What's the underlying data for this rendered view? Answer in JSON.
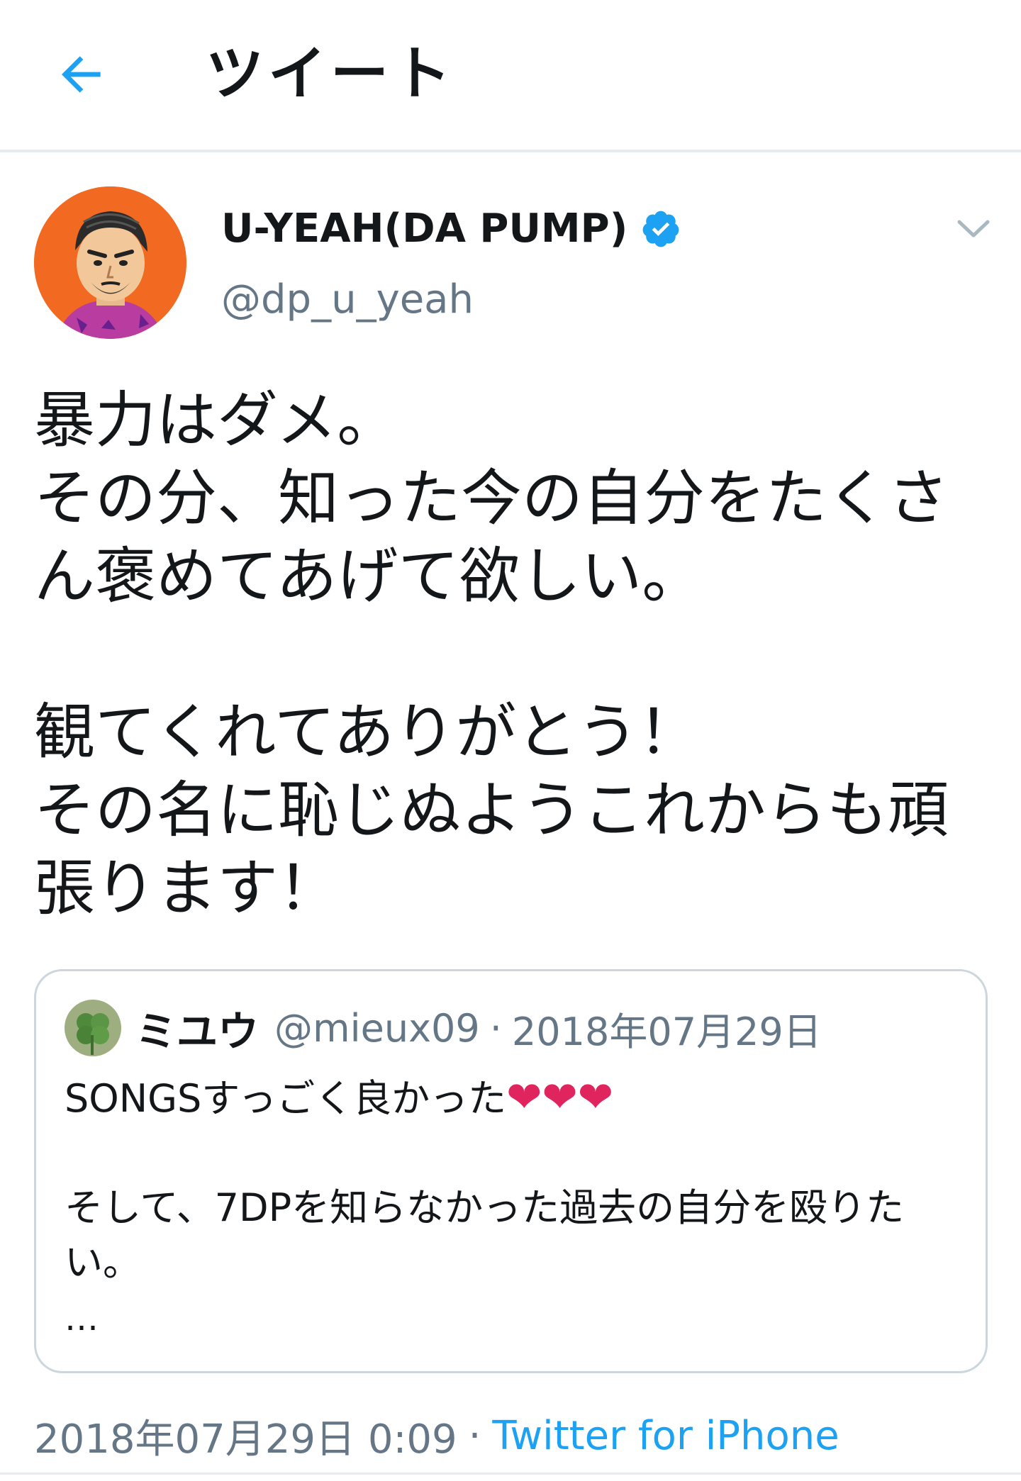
{
  "header": {
    "title": "ツイート",
    "back_icon": "arrow-left-icon",
    "accent_color": "#1da1f2"
  },
  "tweet": {
    "author": {
      "name": "U-YEAH(DA PUMP)",
      "handle": "@dp_u_yeah",
      "verified": true,
      "avatar_icon": "cartoon-avatar"
    },
    "more_icon": "chevron-down-icon",
    "text": "暴力はダメ。\nその分、知った今の自分をたくさん褒めてあげて欲しい。\n\n観てくれてありがとう！\nその名に恥じぬようこれからも頑張ります！",
    "quoted": {
      "name": "ミユウ",
      "handle": "@mieux09",
      "separator": "·",
      "date": "2018年07月29日",
      "text_line1": "SONGSすっごく良かった",
      "hearts": "❤❤❤",
      "text_rest": "そして、7DPを知らなかった過去の自分を殴りたい。",
      "ellipsis": "…"
    },
    "timestamp": "2018年07月29日 0:09",
    "meta_separator": "·",
    "source": "Twitter for iPhone"
  }
}
